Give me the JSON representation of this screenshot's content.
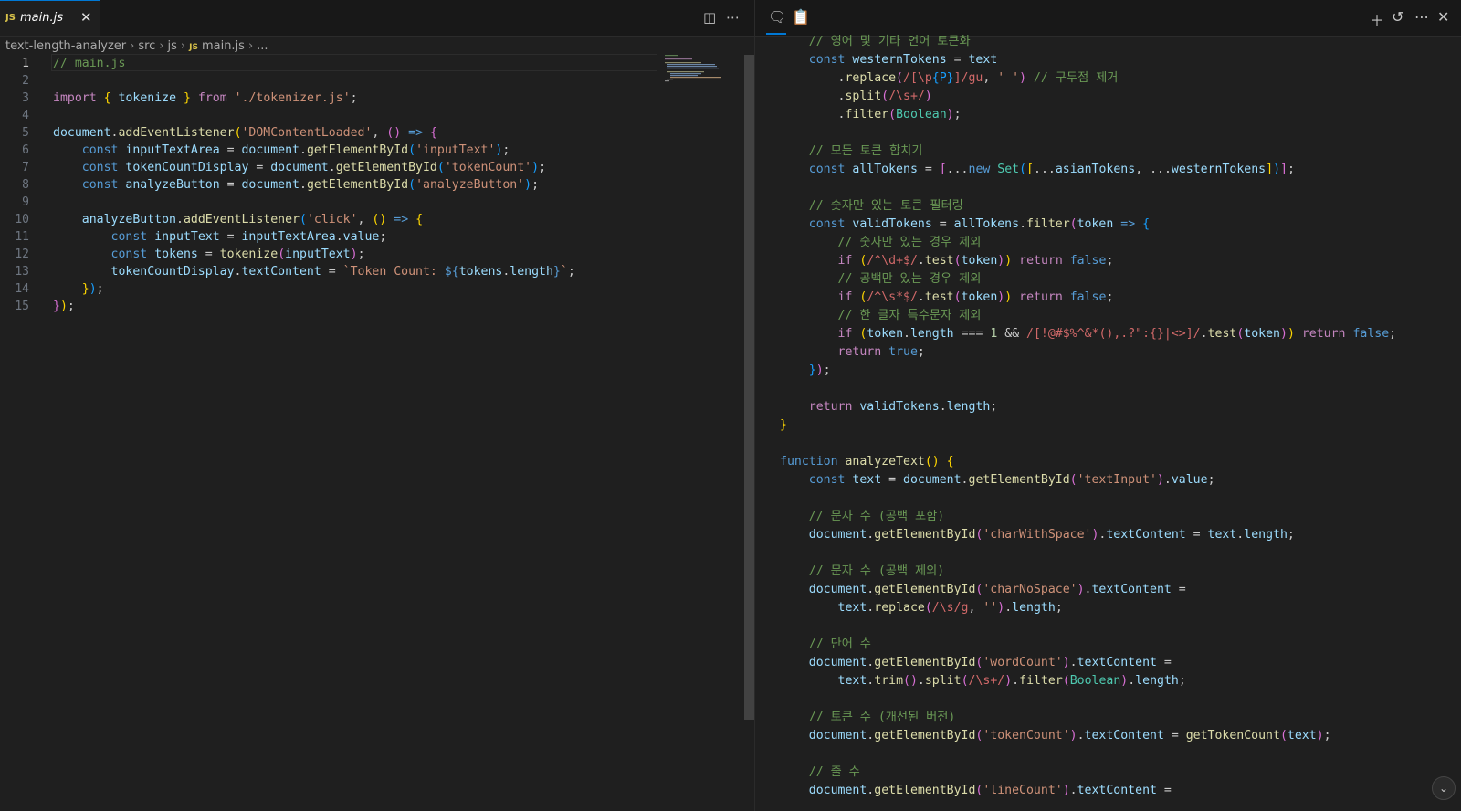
{
  "editor": {
    "tab": {
      "badge": "JS",
      "label": "main.js",
      "close": "✕"
    },
    "toolbar": {
      "split_icon": "split-editor-icon",
      "more_icon": "more-actions-icon"
    },
    "breadcrumb": [
      "text-length-analyzer",
      "src",
      "js",
      "main.js",
      "..."
    ],
    "breadcrumb_badge": "JS",
    "active_line": 1,
    "lines": [
      "1",
      "2",
      "3",
      "4",
      "5",
      "6",
      "7",
      "8",
      "9",
      "10",
      "11",
      "12",
      "13",
      "14",
      "15"
    ]
  },
  "right_panel": {
    "toolbar_icons": [
      "chat-icon",
      "clipboard-icon",
      "add-icon",
      "history-icon",
      "more-icon",
      "close-icon"
    ]
  },
  "colors": {
    "background": "#1f1f1f",
    "tab_accent": "#0078d4",
    "comment": "#6a9955",
    "keyword": "#569cd6",
    "string": "#ce9178",
    "function": "#dcdcaa"
  }
}
